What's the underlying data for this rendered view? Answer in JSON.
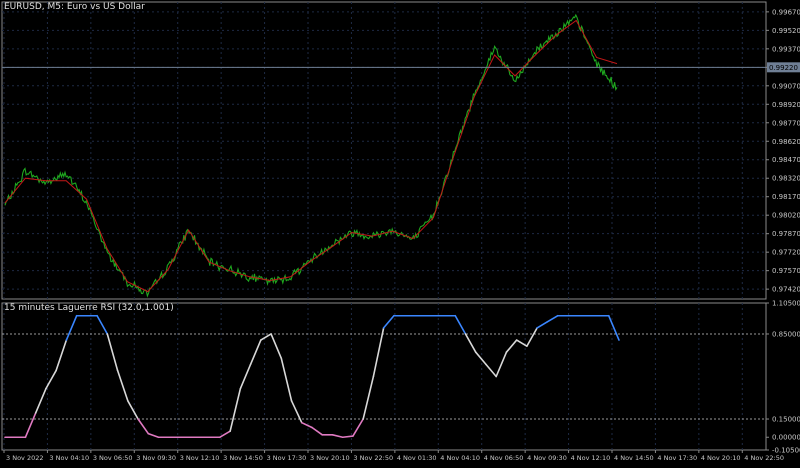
{
  "window": {
    "symbol_title": "EURUSD, M5:  Euro vs US Dollar"
  },
  "colors": {
    "background": "#000000",
    "grid": "#1e2a44",
    "price_line": "#1fa81f",
    "smooth_line": "#c21818",
    "current_price_line": "#6f7f95",
    "rsi_up": "#3a86ff",
    "rsi_mid": "#d8d8d8",
    "rsi_down": "#e07ac2",
    "axis_text": "#c8c8c8"
  },
  "main_chart": {
    "price_axis_labels": [
      "0.99670",
      "0.99520",
      "0.99370",
      "0.99220",
      "0.99070",
      "0.98920",
      "0.98770",
      "0.98620",
      "0.98470",
      "0.98320",
      "0.98170",
      "0.98020",
      "0.97870",
      "0.97720",
      "0.97570",
      "0.97420"
    ],
    "current_price_tag": "0.99220"
  },
  "subwindow": {
    "title": "15 minutes Laguerre RSI (32.0,1.001)",
    "axis_labels": [
      "1.105000",
      "0.850000",
      "0.150000",
      "0.000000",
      "-0.105000"
    ]
  },
  "time_axis_labels": [
    "3 Nov 2022",
    "3 Nov 04:10",
    "3 Nov 06:50",
    "3 Nov 09:30",
    "3 Nov 12:10",
    "3 Nov 14:50",
    "3 Nov 17:30",
    "3 Nov 20:10",
    "3 Nov 22:50",
    "4 Nov 01:30",
    "4 Nov 04:10",
    "4 Nov 06:50",
    "4 Nov 09:30",
    "4 Nov 12:10",
    "4 Nov 14:50",
    "4 Nov 17:30",
    "4 Nov 20:10",
    "4 Nov 22:50"
  ],
  "chart_data": [
    {
      "type": "line",
      "title": "EURUSD, M5:  Euro vs US Dollar",
      "x": [
        "3 Nov 2022",
        "3 Nov 04:10",
        "3 Nov 06:50",
        "3 Nov 09:30",
        "3 Nov 12:10",
        "3 Nov 14:50",
        "3 Nov 17:30",
        "3 Nov 20:10",
        "3 Nov 22:50",
        "4 Nov 01:30",
        "4 Nov 04:10",
        "4 Nov 06:50",
        "4 Nov 09:30",
        "4 Nov 12:10",
        "4 Nov 14:50",
        "4 Nov 17:30",
        "4 Nov 20:10",
        "4 Nov 22:50"
      ],
      "ylim": [
        0.9734,
        0.9975
      ],
      "series": [
        {
          "values": [
            0.981,
            0.9838,
            0.9828,
            0.9836,
            0.9812,
            0.9772,
            0.9748,
            0.9738,
            0.976,
            0.979,
            0.9764,
            0.9758,
            0.9752,
            0.9748,
            0.9752,
            0.9766,
            0.9778,
            0.9788,
            0.9785,
            0.979,
            0.9782,
            0.9802,
            0.9852,
            0.99,
            0.9938,
            0.991,
            0.9935,
            0.995,
            0.9962,
            0.9925,
            0.9905
          ]
        },
        {
          "values": [
            0.9812,
            0.9832,
            0.983,
            0.983,
            0.9815,
            0.9775,
            0.9748,
            0.974,
            0.9758,
            0.979,
            0.9764,
            0.9757,
            0.9752,
            0.9749,
            0.9752,
            0.9765,
            0.9776,
            0.9788,
            0.9785,
            0.9789,
            0.9783,
            0.98,
            0.985,
            0.9898,
            0.9932,
            0.9915,
            0.9932,
            0.9948,
            0.996,
            0.993,
            0.9925
          ]
        }
      ]
    },
    {
      "type": "line",
      "title": "15 minutes Laguerre RSI (32.0,1.001)",
      "ylim": [
        -0.105,
        1.105
      ],
      "series": [
        {
          "values": [
            0.0,
            0.0,
            0.0,
            0.2,
            0.4,
            0.55,
            0.8,
            1.0,
            1.0,
            1.0,
            0.85,
            0.55,
            0.3,
            0.15,
            0.03,
            0.0,
            0.0,
            0.0,
            0.0,
            0.0,
            0.0,
            0.0,
            0.05,
            0.4,
            0.6,
            0.8,
            0.85,
            0.65,
            0.3,
            0.12,
            0.08,
            0.02,
            0.02,
            0.0,
            0.01,
            0.15,
            0.5,
            0.9,
            1.0,
            1.0,
            1.0,
            1.0,
            1.0,
            1.0,
            1.0,
            0.85,
            0.7,
            0.6,
            0.5,
            0.7,
            0.8,
            0.75,
            0.9,
            0.95,
            1.0,
            1.0,
            1.0,
            1.0,
            1.0,
            1.0,
            0.8
          ]
        }
      ]
    }
  ]
}
